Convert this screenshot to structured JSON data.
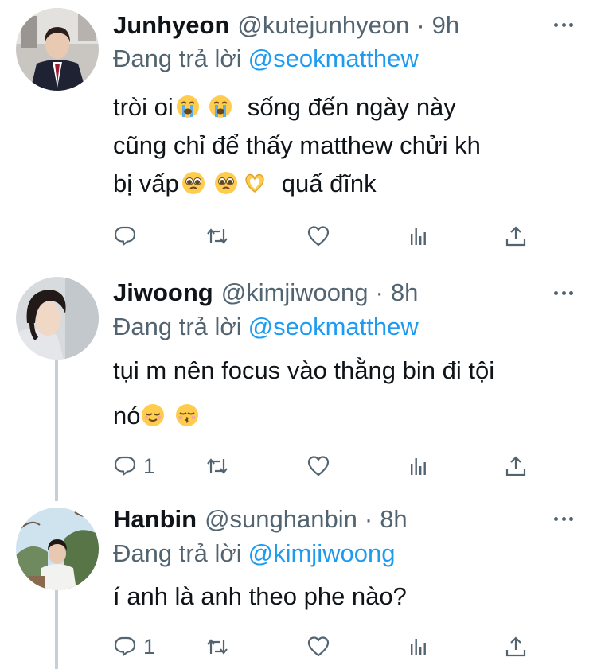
{
  "replying_label": "Đang trả lời",
  "colors": {
    "text": "#0f1419",
    "muted": "#536471",
    "link": "#1d9bf0",
    "divider": "#e6ecf0",
    "thread_line": "#c4cfd6"
  },
  "tweets": [
    {
      "name": "Junhyeon",
      "handle": "@kutejunhyeon",
      "dot": "·",
      "time": "9h",
      "reply_to": "@seokmatthew",
      "lines": [
        {
          "a": "tròi oi",
          "b": "sống đến ngày này"
        },
        {
          "a": "cũng chỉ để thấy matthew chửi kh"
        },
        {
          "a": "bị vấp",
          "b": "quấ đĩnk"
        }
      ],
      "emoji": [
        "loudly-crying-face",
        "loudly-crying-face",
        "pleading-face",
        "pleading-face",
        "heart-hands"
      ],
      "reply_count": "",
      "icons": [
        "reply-icon",
        "retweet-icon",
        "like-icon",
        "stats-icon",
        "share-icon"
      ]
    },
    {
      "name": "Jiwoong",
      "handle": "@kimjiwoong",
      "dot": "·",
      "time": "8h",
      "reply_to": "@seokmatthew",
      "lines": [
        {
          "a": "tụi m nên focus vào thằng bin đi tội"
        },
        {
          "a": "nó"
        }
      ],
      "emoji": [
        "relieved-face",
        "kissing-face"
      ],
      "reply_count": "1"
    },
    {
      "name": "Hanbin",
      "handle": "@sunghanbin",
      "dot": "·",
      "time": "8h",
      "reply_to": "@kimjiwoong",
      "lines": [
        {
          "a": "í anh là anh theo phe nào?"
        }
      ],
      "emoji": [],
      "reply_count": "1"
    }
  ]
}
